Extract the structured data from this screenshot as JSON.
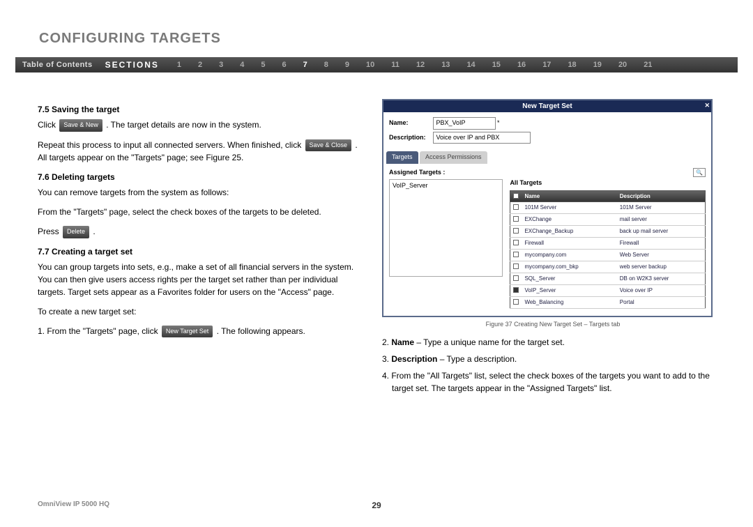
{
  "page_title": "CONFIGURING TARGETS",
  "nav": {
    "toc": "Table of Contents",
    "sections_label": "SECTIONS",
    "numbers": [
      "1",
      "2",
      "3",
      "4",
      "5",
      "6",
      "7",
      "8",
      "9",
      "10",
      "11",
      "12",
      "13",
      "14",
      "15",
      "16",
      "17",
      "18",
      "19",
      "20",
      "21"
    ],
    "active": "7"
  },
  "left": {
    "h75": "7.5 Saving the target",
    "p75a_pre": "Click ",
    "btn_save_new": "Save & New",
    "p75a_post": " . The target details are now in the system.",
    "p75b_pre": "Repeat this process to input all connected servers. When finished, click ",
    "btn_save_close": "Save & Close",
    "p75b_post": " . All targets appear on the \"Targets\" page; see Figure 25.",
    "h76": "7.6 Deleting targets",
    "p76a": "You can remove targets from the system as follows:",
    "p76b": "From the \"Targets\" page, select the check boxes of the targets to be deleted.",
    "p76c_pre": "Press ",
    "btn_delete": "Delete",
    "p76c_post": " .",
    "h77": "7.7 Creating a target set",
    "p77a": "You can group targets into sets, e.g., make a set of all financial servers in the system. You can then give users access rights per the target set rather than per individual targets. Target sets appear as a Favorites folder for users on the \"Access\" page.",
    "p77b": "To create a new target set:",
    "p77c_pre": "1. From the \"Targets\" page, click ",
    "btn_new_target_set": "New Target Set",
    "p77c_post": " . The following appears."
  },
  "screenshot": {
    "title": "New Target Set",
    "name_label": "Name:",
    "name_value": "PBX_VoIP",
    "desc_label": "Description:",
    "desc_value": "Voice over IP and PBX",
    "tab_targets": "Targets",
    "tab_access": "Access Permissions",
    "assigned_title": "Assigned Targets :",
    "assigned_items": [
      "VoIP_Server"
    ],
    "all_title": "All Targets",
    "column_name": "Name",
    "column_desc": "Description",
    "rows": [
      {
        "checked": false,
        "name": "101M Server",
        "desc": "101M Server"
      },
      {
        "checked": false,
        "name": "EXChange",
        "desc": "mail server"
      },
      {
        "checked": false,
        "name": "EXChange_Backup",
        "desc": "back up mail server"
      },
      {
        "checked": false,
        "name": "Firewall",
        "desc": "Firewall"
      },
      {
        "checked": false,
        "name": "mycompany.com",
        "desc": "Web Server"
      },
      {
        "checked": false,
        "name": "mycompany.com_bkp",
        "desc": "web server backup"
      },
      {
        "checked": false,
        "name": "SQL_Server",
        "desc": "DB on W2K3 server"
      },
      {
        "checked": true,
        "name": "VoIP_Server",
        "desc": "Voice over IP"
      },
      {
        "checked": false,
        "name": "Web_Balancing",
        "desc": "Portal"
      }
    ]
  },
  "fig_caption": "Figure 37 Creating New Target Set – Targets tab",
  "right": {
    "step2_num": "2. ",
    "step2_bold": "Name",
    "step2_rest": " – Type a unique name for the target set.",
    "step3_num": "3. ",
    "step3_bold": "Description",
    "step3_rest": " – Type a description.",
    "step4": "4. From the \"All Targets\" list, select the check boxes of the targets you want to add to the target set. The targets appear in the \"Assigned Targets\" list."
  },
  "footer": {
    "product": "OmniView IP 5000 HQ",
    "page_num": "29"
  }
}
